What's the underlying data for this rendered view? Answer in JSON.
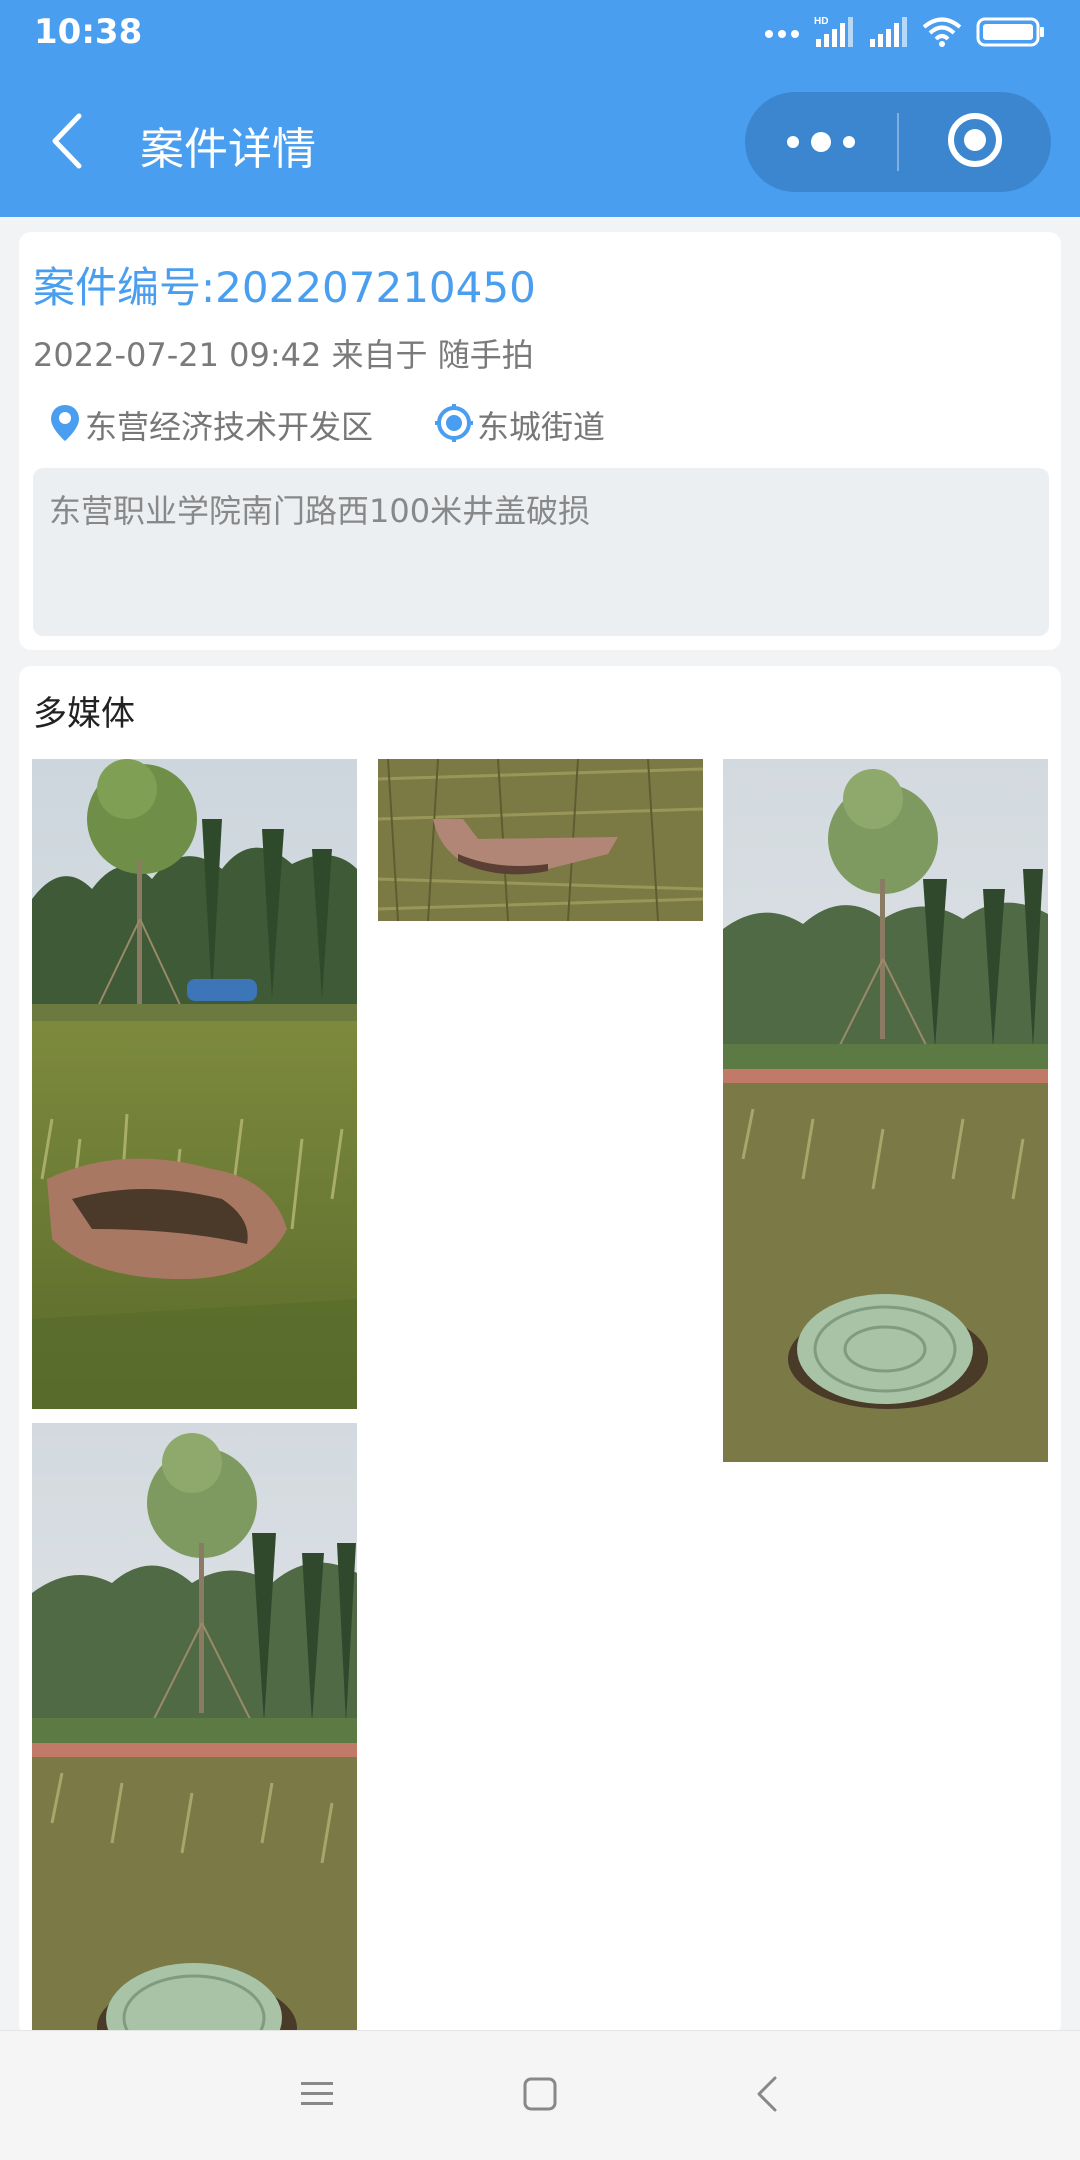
{
  "status_bar": {
    "time": "10:38",
    "icons": [
      "dots-icon",
      "hd-signal-icon",
      "signal-icon",
      "wifi-icon",
      "battery-icon"
    ]
  },
  "nav": {
    "title": "案件详情",
    "back_icon": "chevron-left-icon",
    "capsule_more_icon": "more-dots-icon",
    "capsule_close_icon": "target-close-icon",
    "bar_color": "#4a9eef"
  },
  "case": {
    "case_no": "案件编号:202207210450",
    "meta": "2022-07-21 09:42 来自于 随手拍",
    "district": "东营经济技术开发区",
    "street": "东城街道",
    "description": "东营职业学院南门路西100米井盖破损",
    "accent_color": "#4a9eef"
  },
  "media": {
    "title": "多媒体",
    "photos": [
      {
        "name": "photo-broken-manhole-wide",
        "subject": "broken manhole cover in grass with tree and car"
      },
      {
        "name": "photo-broken-manhole-closeup",
        "subject": "broken manhole cover close-up"
      },
      {
        "name": "photo-new-manhole-1",
        "subject": "green manhole cover in grass with tree"
      },
      {
        "name": "photo-new-manhole-2",
        "subject": "green manhole cover in grass with tree"
      }
    ]
  },
  "system_nav": {
    "menu_icon": "menu-icon",
    "home_icon": "home-square-icon",
    "back_icon": "back-triangle-icon"
  }
}
